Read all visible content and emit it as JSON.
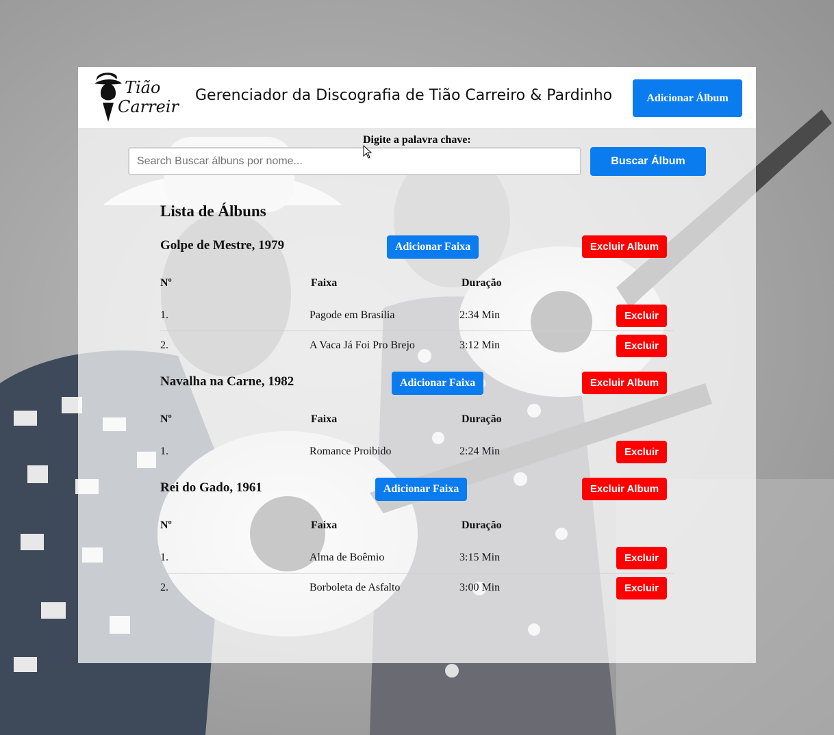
{
  "header": {
    "logo_text_line1": "Tião",
    "logo_text_line2": "Carreiro",
    "title": "Gerenciador da Discografia de Tião Carreiro & Pardinho",
    "add_album_label": "Adicionar Álbum"
  },
  "search": {
    "label": "Digite a palavra chave:",
    "placeholder": "Search Buscar álbuns por nome...",
    "value": "",
    "button_label": "Buscar Álbum"
  },
  "list": {
    "title": "Lista de Álbuns",
    "columns": {
      "number": "Nº",
      "track": "Faixa",
      "duration": "Duração"
    },
    "add_track_label": "Adicionar Faixa",
    "delete_album_label": "Excluir Album",
    "delete_track_label": "Excluir",
    "albums": [
      {
        "name": "Golpe de Mestre, 1979",
        "tracks": [
          {
            "number": "1.",
            "title": "Pagode em Brasília",
            "duration": "2:34 Min"
          },
          {
            "number": "2.",
            "title": "A Vaca Já Foi Pro Brejo",
            "duration": "3:12 Min"
          }
        ]
      },
      {
        "name": "Navalha na Carne, 1982",
        "tracks": [
          {
            "number": "1.",
            "title": "Romance Proibido",
            "duration": "2:24 Min"
          }
        ]
      },
      {
        "name": "Rei do Gado, 1961",
        "tracks": [
          {
            "number": "1.",
            "title": "Alma de Boêmio",
            "duration": "3:15 Min"
          },
          {
            "number": "2.",
            "title": "Borboleta de Asfalto",
            "duration": "3:00 Min"
          }
        ]
      }
    ]
  },
  "colors": {
    "primary_blue": "#0a7cf0",
    "danger_red": "#ff0000",
    "card_background": "rgba(255,255,255,0.72)"
  },
  "icons": {
    "logo": "cowboy-hat-man-icon",
    "cursor": "mouse-pointer-icon"
  }
}
